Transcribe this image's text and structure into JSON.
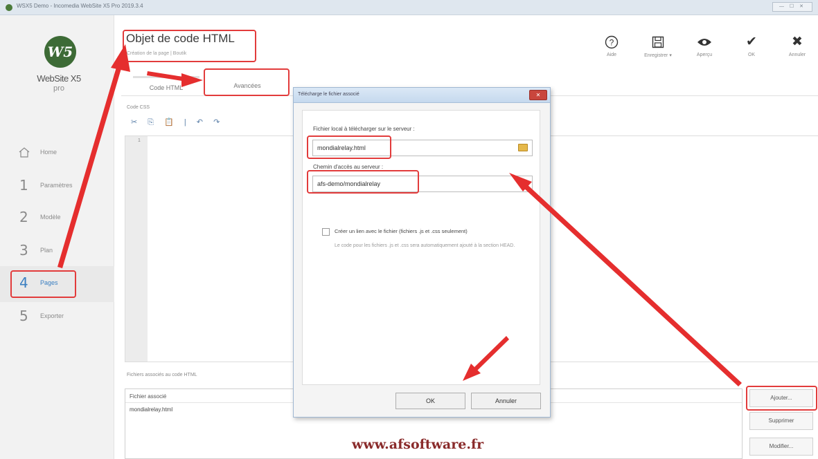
{
  "window": {
    "title": "WSX5 Demo - Incomedia WebSite X5 Pro 2019.3.4",
    "controls": "— ☐ ✕"
  },
  "brand": {
    "logo_text": "W5",
    "name": "WebSite X5",
    "edition": "pro"
  },
  "sidebar": {
    "items": [
      {
        "num": "",
        "label": "Home"
      },
      {
        "num": "1",
        "label": "Paramètres"
      },
      {
        "num": "2",
        "label": "Modèle"
      },
      {
        "num": "3",
        "label": "Plan"
      },
      {
        "num": "4",
        "label": "Pages"
      },
      {
        "num": "5",
        "label": "Exporter"
      }
    ]
  },
  "header": {
    "title": "Objet de code HTML",
    "subtitle": "Création de la page | Boutik"
  },
  "toolbar": {
    "help": {
      "icon": "?",
      "label": "Aide"
    },
    "save": {
      "icon": "🖫",
      "label": "Enregistrer ▾"
    },
    "preview": {
      "icon": "👁",
      "label": "Aperçu"
    },
    "ok": {
      "icon": "✔",
      "label": "OK"
    },
    "cancel": {
      "icon": "✖",
      "label": "Annuler"
    }
  },
  "tabs": [
    {
      "label": "Code HTML"
    },
    {
      "label": "Avancées"
    }
  ],
  "editor": {
    "label": "Code CSS",
    "tools": "✂ ⎘ 📋 | ↶ ↷",
    "line_number": "1"
  },
  "files": {
    "label": "Fichiers associés au code HTML",
    "column_header": "Fichier associé",
    "rows": [
      "mondialrelay.html"
    ],
    "buttons": {
      "add": "Ajouter...",
      "remove": "Supprimer",
      "edit": "Modifier..."
    }
  },
  "dialog": {
    "title": "Télécharge le fichier associé",
    "close": "✕",
    "file_label": "Fichier local à télécharger sur le serveur :",
    "file_value": "mondialrelay.html",
    "path_label": "Chemin d'accès au serveur :",
    "path_value": "afs-demo/mondialrelay",
    "checkbox_label": "Créer un lien avec le fichier (fichiers .js et .css seulement)",
    "note": "Le code pour les fichiers .js et .css sera automatiquement ajouté à la section HEAD.",
    "ok": "OK",
    "cancel": "Annuler"
  },
  "watermark": "www.afsoftware.fr",
  "colors": {
    "highlight": "#e23b3b",
    "accent": "#3a7fc1",
    "logo": "#3d6b36"
  }
}
